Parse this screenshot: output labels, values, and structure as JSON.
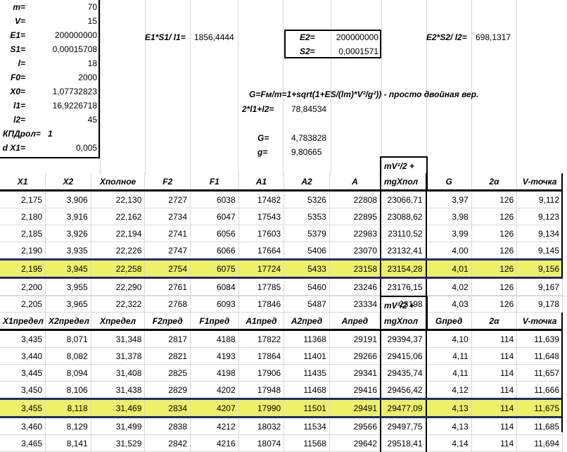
{
  "params": [
    {
      "label": "m=",
      "value": "70"
    },
    {
      "label": "V=",
      "value": "15"
    },
    {
      "label": "E1=",
      "value": "200000000"
    },
    {
      "label": "S1=",
      "value": "0,00015708"
    },
    {
      "label": "l=",
      "value": "18"
    },
    {
      "label": "F0=",
      "value": "2000"
    },
    {
      "label": "X0=",
      "value": "1,07732823"
    },
    {
      "label": "l1=",
      "value": "16,9226718"
    },
    {
      "label": "l2=",
      "value": "45"
    },
    {
      "label": "КПДрол=",
      "value": "1"
    },
    {
      "label": "d X1=",
      "value": "0,005"
    }
  ],
  "calc": {
    "e1s1_label": "E1*S1/ l1=",
    "e1s1_value": "1856,4444",
    "e2_label": "E2=",
    "e2_value": "200000000",
    "s2_label": "S2=",
    "s2_value": "0,0001571",
    "e2s2_label": "E2*S2/ l2=",
    "e2s2_value": "698,1317",
    "formula": "G=Fм/m=1+sqrt(1+ES/(lm)*V²/g²)) - просто двойная вер.",
    "sum_label": "2*l1+l2=",
    "sum_value": "78,84534",
    "g_cap_label": "G=",
    "g_cap_value": "4,783828",
    "g_label": "g=",
    "g_value": "9,80665"
  },
  "table1": {
    "mv_line1": "mV²/2 +",
    "headers": [
      "X1",
      "X2",
      "Xполное",
      "F2",
      "F1",
      "A1",
      "A2",
      "A",
      "mgXпол",
      "G",
      "2α",
      "V-точка"
    ],
    "rows": [
      [
        "2,175",
        "3,906",
        "22,130",
        "2727",
        "6038",
        "17482",
        "5326",
        "22808",
        "23066,71",
        "3,97",
        "126",
        "9,112"
      ],
      [
        "2,180",
        "3,916",
        "22,162",
        "2734",
        "6047",
        "17543",
        "5353",
        "22895",
        "23088,62",
        "3,98",
        "126",
        "9,123"
      ],
      [
        "2,185",
        "3,926",
        "22,194",
        "2741",
        "6056",
        "17603",
        "5379",
        "22983",
        "23110,52",
        "3,99",
        "126",
        "9,134"
      ],
      [
        "2,190",
        "3,935",
        "22,226",
        "2747",
        "6066",
        "17664",
        "5406",
        "23070",
        "23132,41",
        "4,00",
        "126",
        "9,145"
      ],
      [
        "2,195",
        "3,945",
        "22,258",
        "2754",
        "6075",
        "17724",
        "5433",
        "23158",
        "23154,28",
        "4,01",
        "126",
        "9,156"
      ],
      [
        "2,200",
        "3,955",
        "22,290",
        "2761",
        "6084",
        "17785",
        "5460",
        "23246",
        "23176,15",
        "4,02",
        "126",
        "9,167"
      ],
      [
        "2,205",
        "3,965",
        "22,322",
        "2768",
        "6093",
        "17846",
        "5487",
        "23334",
        "23198",
        "4,03",
        "126",
        "9,178"
      ]
    ],
    "highlight_row": 4
  },
  "table2": {
    "mv_line1": "mV²/2 +",
    "headers": [
      "X1предел",
      "X2предел",
      "Xпредел",
      "F2пред",
      "F1пред",
      "A1пред",
      "A2пред",
      "Aпред",
      "mgXпол",
      "Gпред",
      "2α",
      "V-точка"
    ],
    "rows": [
      [
        "3,435",
        "8,071",
        "31,348",
        "2817",
        "4188",
        "17822",
        "11368",
        "29191",
        "29394,37",
        "4,10",
        "114",
        "11,639"
      ],
      [
        "3,440",
        "8,082",
        "31,378",
        "2821",
        "4193",
        "17864",
        "11401",
        "29266",
        "29415,06",
        "4,11",
        "114",
        "11,648"
      ],
      [
        "3,445",
        "8,094",
        "31,408",
        "2825",
        "4198",
        "17906",
        "11435",
        "29341",
        "29435,74",
        "4,11",
        "114",
        "11,657"
      ],
      [
        "3,450",
        "8,106",
        "31,438",
        "2829",
        "4202",
        "17948",
        "11468",
        "29416",
        "29456,42",
        "4,12",
        "114",
        "11,666"
      ],
      [
        "3,455",
        "8,118",
        "31,469",
        "2834",
        "4207",
        "17990",
        "11501",
        "29491",
        "29477,09",
        "4,13",
        "114",
        "11,675"
      ],
      [
        "3,460",
        "8,129",
        "31,499",
        "2838",
        "4212",
        "18032",
        "11534",
        "29566",
        "29497,75",
        "4,13",
        "114",
        "11,685"
      ],
      [
        "3,465",
        "8,141",
        "31,529",
        "2842",
        "4216",
        "18074",
        "11568",
        "29642",
        "29518,41",
        "4,14",
        "114",
        "11,694"
      ]
    ],
    "highlight_row": 4
  }
}
